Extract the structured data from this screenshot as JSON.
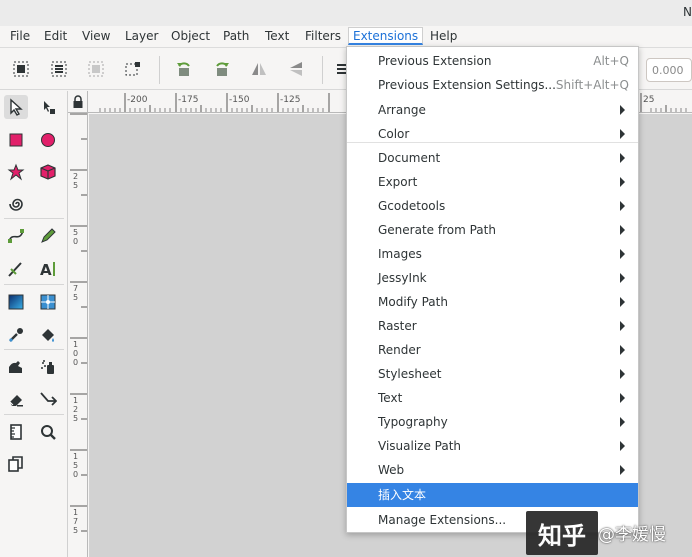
{
  "window": {
    "title_fragment": "N"
  },
  "menubar": {
    "items": [
      "File",
      "Edit",
      "View",
      "Layer",
      "Object",
      "Path",
      "Text",
      "Filters",
      "Extensions",
      "Help"
    ],
    "active": "Extensions"
  },
  "toolbar": {
    "coordinate_value": "0.000"
  },
  "ruler": {
    "h_labels": [
      "-200",
      "-175",
      "-150",
      "-125",
      "25"
    ],
    "v_labels": [
      "2\n5",
      "5\n0",
      "7\n5",
      "1\n0\n0",
      "1\n2\n5",
      "1\n5\n0",
      "1\n7\n5"
    ]
  },
  "extensions_menu": {
    "top_items": [
      {
        "label": "Previous Extension",
        "accel": "Alt+Q"
      },
      {
        "label": "Previous Extension Settings...",
        "accel": "Shift+Alt+Q"
      }
    ],
    "submenus": [
      "Arrange",
      "Color",
      "Document",
      "Export",
      "Gcodetools",
      "Generate from Path",
      "Images",
      "JessyInk",
      "Modify Path",
      "Raster",
      "Render",
      "Stylesheet",
      "Text",
      "Typography",
      "Visualize Path",
      "Web"
    ],
    "highlighted_item": "插入文本",
    "last_item": "Manage Extensions...",
    "highlight_color": "#3584e4"
  },
  "watermark": {
    "brand": "知乎",
    "user": "@李媛慢",
    "underlying_text": "插入文本"
  }
}
